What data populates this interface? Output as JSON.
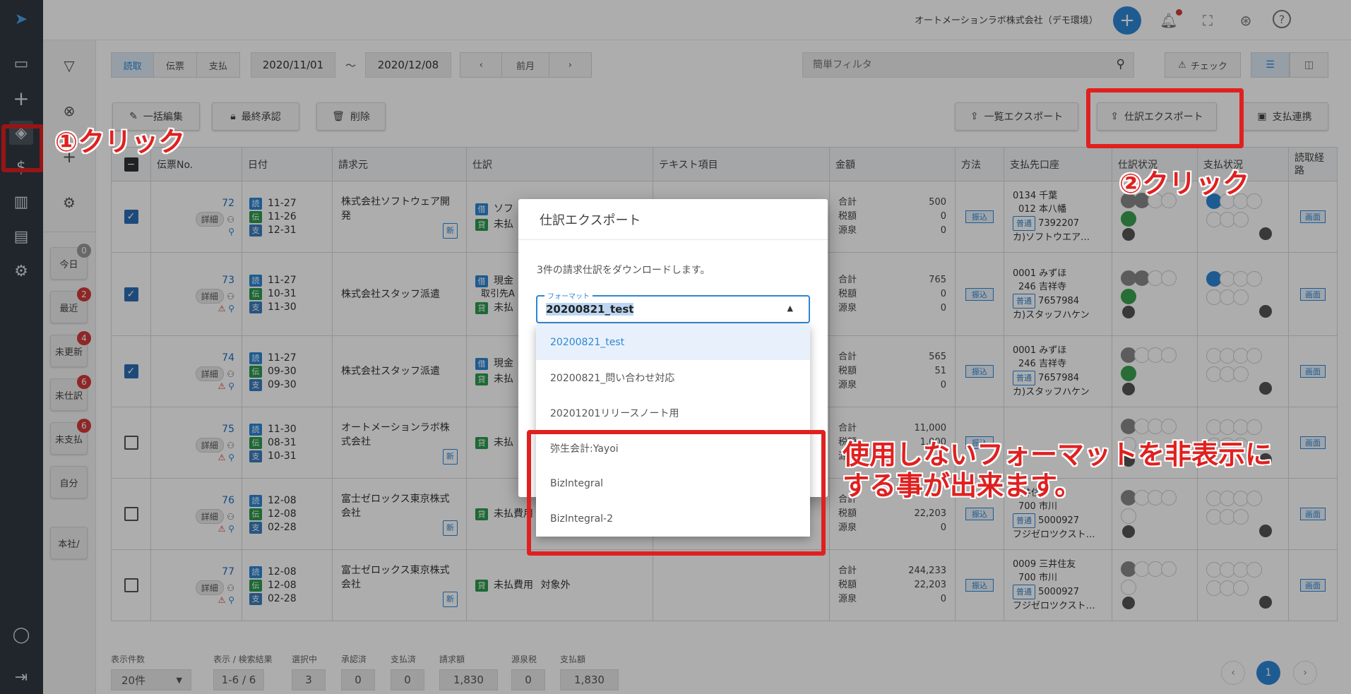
{
  "company": "オートメーションラボ株式会社（デモ環境）",
  "tabs": [
    "読取",
    "伝票",
    "支払"
  ],
  "date_from": "2020/11/01",
  "date_sep": "〜",
  "date_to": "2020/12/08",
  "prev_month": "前月",
  "filter_placeholder": "簡単フィルタ",
  "check_label": "チェック",
  "actions": {
    "bulk_edit": "一括編集",
    "final_approve": "最終承認",
    "delete": "削除",
    "list_export": "一覧エクスポート",
    "journal_export": "仕訳エクスポート",
    "payment_link": "支払連携"
  },
  "quick": [
    {
      "label": "今日",
      "count": "0"
    },
    {
      "label": "最近",
      "count": "2"
    },
    {
      "label": "未更新",
      "count": "4"
    },
    {
      "label": "未仕訳",
      "count": "6"
    },
    {
      "label": "未支払",
      "count": "6"
    },
    {
      "label": "自分",
      "count": ""
    },
    {
      "label": "本社/",
      "count": ""
    }
  ],
  "columns": [
    "伝票No.",
    "日付",
    "請求元",
    "仕訳",
    "テキスト項目",
    "金額",
    "方法",
    "支払先口座",
    "仕訳状況",
    "支払状況",
    "読取経路"
  ],
  "rows": [
    {
      "no": "72",
      "checked": true,
      "d1": "11-27",
      "d2": "11-26",
      "d3": "12-31",
      "vendor": "株式会社ソフトウェア開発",
      "new": true,
      "j1": "ソフ",
      "j2": "未払",
      "total": "500",
      "tax": "0",
      "src": "0",
      "acct1": "0134 千葉",
      "acct2": "012 本八幡",
      "acct3": "7392207",
      "acct4": "カ)ソフトウエア…"
    },
    {
      "no": "73",
      "checked": true,
      "d1": "11-27",
      "d2": "10-31",
      "d3": "11-30",
      "vendor": "株式会社スタッフ派遣",
      "new": false,
      "j1": "現金",
      "j1b": "取引先A",
      "j2": "未払",
      "total": "765",
      "tax": "0",
      "src": "0",
      "acct1": "0001 みずほ",
      "acct2": "246 吉祥寺",
      "acct3": "7657984",
      "acct4": "カ)スタッフハケン"
    },
    {
      "no": "74",
      "checked": true,
      "d1": "11-27",
      "d2": "09-30",
      "d3": "09-30",
      "vendor": "株式会社スタッフ派遣",
      "new": false,
      "j1": "現金",
      "j2": "未払",
      "total": "565",
      "tax": "51",
      "src": "0",
      "acct1": "0001 みずほ",
      "acct2": "246 吉祥寺",
      "acct3": "7657984",
      "acct4": "カ)スタッフハケン"
    },
    {
      "no": "75",
      "checked": false,
      "d1": "11-30",
      "d2": "08-31",
      "d3": "10-31",
      "vendor": "オートメーションラボ株式会社",
      "new": true,
      "j2": "未払",
      "total": "11,000",
      "tax": "1,000",
      "src": "",
      "acct1": "",
      "acct2": "",
      "acct3": "",
      "acct4": ""
    },
    {
      "no": "76",
      "checked": false,
      "d1": "12-08",
      "d2": "12-08",
      "d3": "02-28",
      "vendor": "富士ゼロックス東京株式会社",
      "new": true,
      "j2": "未払費用",
      "total": "",
      "tax": "22,203",
      "src": "0",
      "acct1": "三井住",
      "acct2": "700 市川",
      "acct3": "5000927",
      "acct4": "フジゼロツクスト…"
    },
    {
      "no": "77",
      "checked": false,
      "d1": "12-08",
      "d2": "12-08",
      "d3": "02-28",
      "vendor": "富士ゼロックス東京株式会社",
      "new": true,
      "j2": "未払費用",
      "j2b": "対象外",
      "total": "244,233",
      "tax": "22,203",
      "src": "0",
      "acct1": "0009 三井住友",
      "acct2": "700 市川",
      "acct3": "5000927",
      "acct4": "フジゼロツクスト…"
    }
  ],
  "labels": {
    "detail": "詳細",
    "new": "新",
    "total": "合計",
    "tax": "税額",
    "src": "源泉",
    "furi": "振込",
    "futsu": "普通",
    "screen": "画面",
    "yomi": "読",
    "den": "伝",
    "shi": "支",
    "kari": "借",
    "kashi": "貸"
  },
  "dialog": {
    "title": "仕訳エクスポート",
    "message": "3件の請求仕訳をダウンロードします。",
    "format_label": "フォーマット",
    "format_value": "20200821_test"
  },
  "format_options": [
    "20200821_test",
    "20200821_問い合わせ対応",
    "20201201リリースノート用",
    "弥生会計:Yayoi",
    "BizIntegral",
    "BizIntegral-2"
  ],
  "annotations": {
    "step1": "①クリック",
    "step2": "②クリック",
    "note1": "使用しないフォーマットを非表示に",
    "note2": "する事が出来ます。"
  },
  "footer": {
    "per_page_label": "表示件数",
    "per_page": "20件",
    "range_label": "表示 / 検索結果",
    "range": "1-6 / 6",
    "selected_label": "選択中",
    "selected": "3",
    "approved_label": "承認済",
    "approved": "0",
    "paid_label": "支払済",
    "paid": "0",
    "billed_label": "請求額",
    "billed": "1,830",
    "withholding_label": "源泉税",
    "withholding": "0",
    "payment_label": "支払額",
    "payment": "1,830",
    "page": "1"
  },
  "colors": {
    "rail": "#303841",
    "accent": "#2d86d6",
    "annotation": "#e02020"
  }
}
